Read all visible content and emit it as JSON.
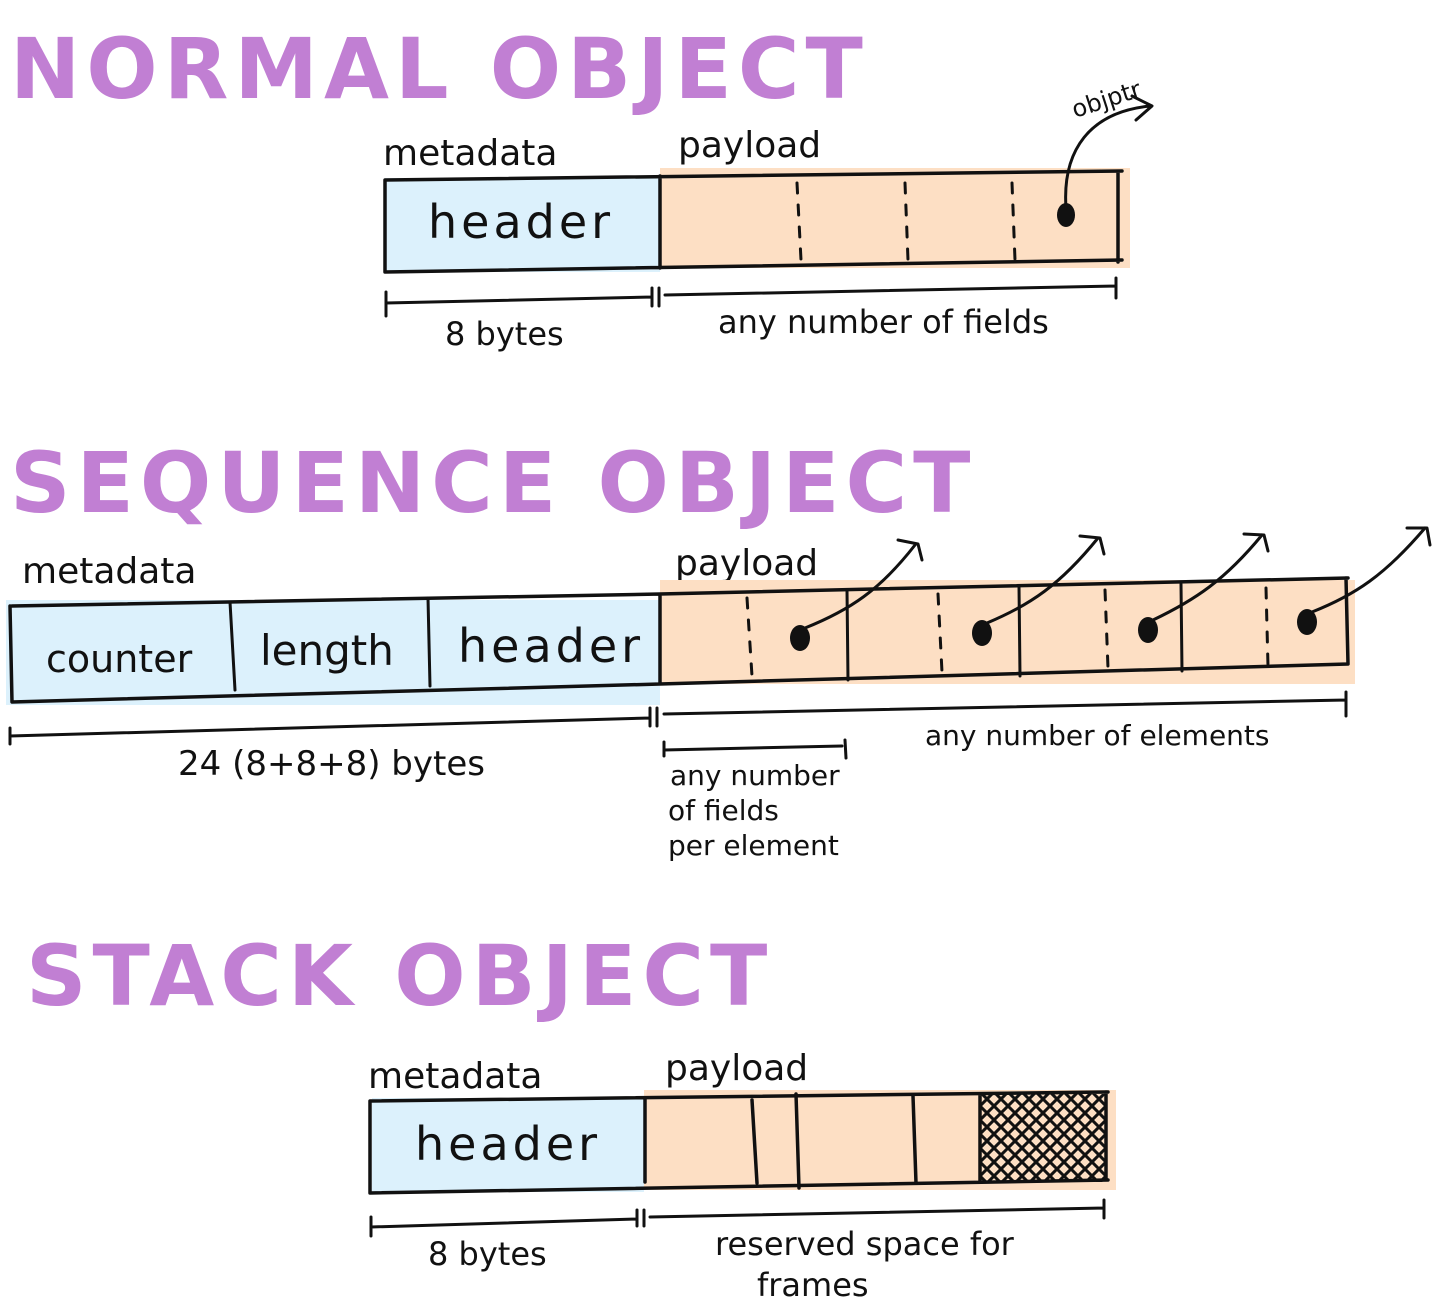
{
  "colors": {
    "title": "#c17fd3",
    "metadata_fill": "#dcf1fc",
    "payload_fill": "#fddfc4",
    "ink": "#111111"
  },
  "normal": {
    "title": "NORMAL OBJECT",
    "metadata_label": "metadata",
    "payload_label": "payload",
    "header_label": "header",
    "pointer_label": "objptr",
    "metadata_size": "8 bytes",
    "payload_size": "any number of fields"
  },
  "sequence": {
    "title": "SEQUENCE OBJECT",
    "metadata_label": "metadata",
    "payload_label": "payload",
    "fields": [
      "counter",
      "length",
      "header"
    ],
    "metadata_size": "24 (8+8+8) bytes",
    "element_size_lines": [
      "any number",
      "of fields",
      "per element"
    ],
    "payload_size": "any number of elements"
  },
  "stack": {
    "title": "STACK OBJECT",
    "metadata_label": "metadata",
    "payload_label": "payload",
    "header_label": "header",
    "metadata_size": "8 bytes",
    "payload_size_lines": [
      "reserved space for",
      "frames"
    ]
  }
}
